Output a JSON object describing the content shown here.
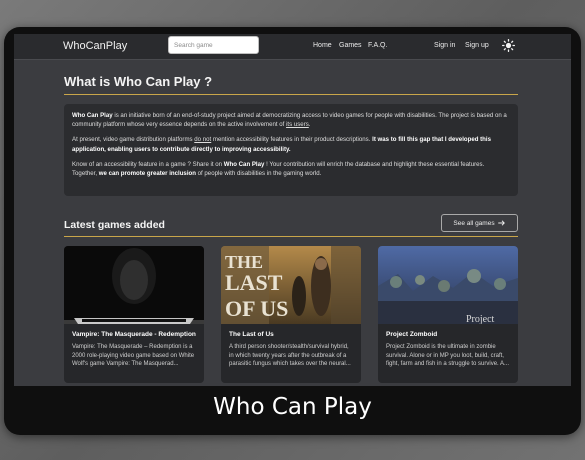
{
  "navbar": {
    "brand": "WhoCanPlay",
    "search_placeholder": "Search game",
    "links": {
      "home": "Home",
      "games": "Games",
      "faq": "F.A.Q."
    },
    "sign_in": "Sign in",
    "sign_up": "Sign up",
    "theme_icon": "sun-icon"
  },
  "about": {
    "title": "What is Who Can Play ?",
    "p1_brand": "Who Can Play",
    "p1_text": " is an initiative born of an end-of-study project aimed at democratizing access to video games for people with disabilities. The project is based on a community platform whose very essence depends on the active involvement of ",
    "p1_link": "its users",
    "p1_end": ".",
    "p2_start": "At present, video game distribution platforms ",
    "p2_emph": "do not",
    "p2_mid": " mention accessibility features in their product descriptions. ",
    "p2_bold": "It was to fill this gap that I developed this application, enabling users to contribute directly to improving accessibility.",
    "p3_start": "Know of an accessibility feature in a game ? Share it on ",
    "p3_brand": "Who Can Play",
    "p3_mid": " ! Your contribution will enrich the database and highlight these essential features. Together, ",
    "p3_bold": "we can promote greater inclusion",
    "p3_end": " of people with disabilities in the gaming world."
  },
  "latest": {
    "title": "Latest games added",
    "see_all": "See all games",
    "see_all_icon": "arrow-right-icon",
    "games": [
      {
        "title": "Vampire: The Masquerade - Redemption",
        "description": "Vampire: The Masquerade – Redemption is a 2000 role-playing video game based on White Wolf's game Vampire: The Masquerad..."
      },
      {
        "title": "The Last of Us",
        "description": "A third person shooter/stealth/survival hybrid, in which twenty years after the outbreak of a parasitic fungus which takes over the neural..."
      },
      {
        "title": "Project Zomboid",
        "description": "Project Zomboid is the ultimate in zombie survival. Alone or in MP you loot, build, craft, fight, farm and fish in a struggle to survive. A..."
      }
    ]
  },
  "caption": "Who Can Play",
  "colors": {
    "accent": "#c9a64a",
    "background": "#3b3c40",
    "navbar": "#2a2b2e",
    "box": "#2b2c2f"
  }
}
